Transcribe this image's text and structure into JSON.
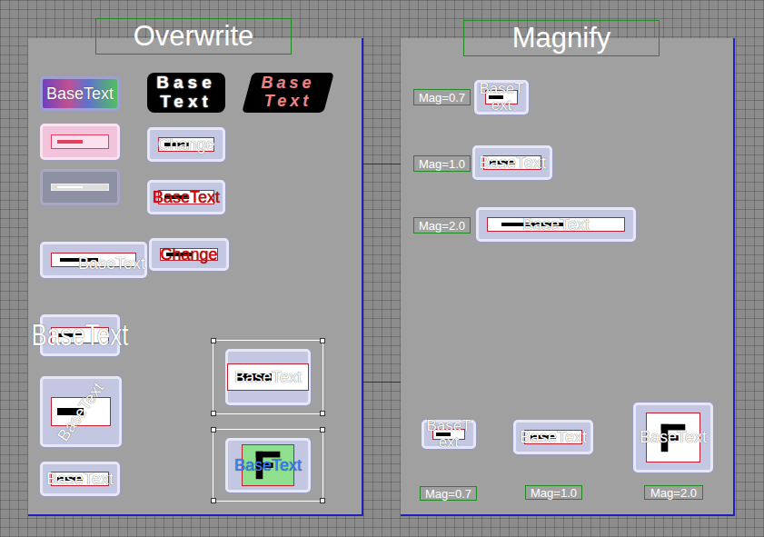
{
  "panels": [
    {
      "title": "Overwrite",
      "items": [
        {
          "kind": "gradient",
          "text": "BaseText",
          "color": "#ffffff"
        },
        {
          "kind": "bubble",
          "text": "Base Text",
          "color": "#ffffff"
        },
        {
          "kind": "italic",
          "text": "Base Text",
          "color": "#f08080"
        },
        {
          "kind": "pink"
        },
        {
          "kind": "plain",
          "text": "Change",
          "color": "#ffffff"
        },
        {
          "kind": "gray"
        },
        {
          "kind": "plain",
          "text": "BaseText",
          "color": "#e00000"
        },
        {
          "kind": "plain",
          "text": "BaseText",
          "color": "#ffffff"
        },
        {
          "kind": "plain",
          "text": "Change",
          "color": "#e00000"
        },
        {
          "kind": "big",
          "text": "BaseText",
          "color": "#ffffff"
        },
        {
          "kind": "rotated",
          "text": "BaseText",
          "color": "#ffffff"
        },
        {
          "kind": "plain",
          "text": "BaseText",
          "color": "#ffffff"
        },
        {
          "kind": "selected",
          "text": "BaseText",
          "color": "#ffffff"
        },
        {
          "kind": "green",
          "text": "BaseText",
          "color": "#3080ff"
        }
      ]
    },
    {
      "title": "Magnify",
      "items": [
        {
          "kind": "plain",
          "text": "BaseText",
          "color": "#ffffff",
          "mag": "Mag=0.7"
        },
        {
          "kind": "plain",
          "text": "BaseText",
          "color": "#ffffff",
          "mag": "Mag=1.0"
        },
        {
          "kind": "plain",
          "text": "BaseText",
          "color": "#ffffff",
          "mag": "Mag=2.0"
        },
        {
          "kind": "plain",
          "text": "BaseText",
          "color": "#ffffff",
          "mag": "Mag=0.7"
        },
        {
          "kind": "plain",
          "text": "BaseText",
          "color": "#ffffff",
          "mag": "Mag=1.0"
        },
        {
          "kind": "icon",
          "text": "BaseText",
          "color": "#ffffff",
          "mag": "Mag=2.0"
        }
      ]
    }
  ]
}
